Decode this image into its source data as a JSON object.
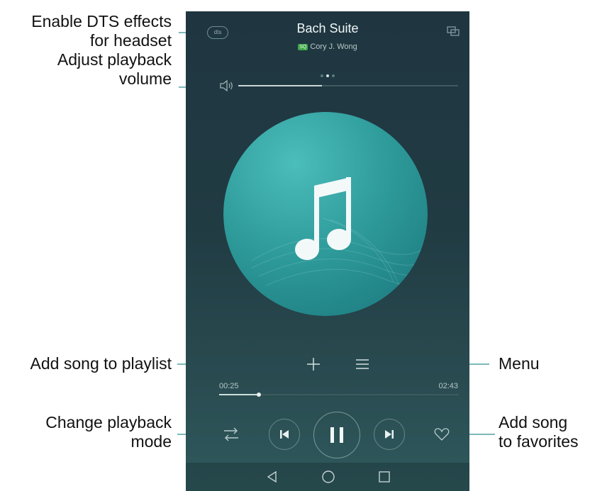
{
  "callouts": {
    "dts": "Enable DTS effects for headset",
    "dts_line1": "Enable DTS effects",
    "dts_line2": "for headset",
    "volume_line1": "Adjust playback",
    "volume_line2": "volume",
    "playlist": "Add song to playlist",
    "menu": "Menu",
    "mode_line1": "Change playback",
    "mode_line2": "mode",
    "fav_line1": "Add song",
    "fav_line2": "to favorites"
  },
  "player": {
    "title": "Bach Suite",
    "artist": "Cory J. Wong",
    "quality_badge": "SQ",
    "dts_label": "dts",
    "elapsed": "00:25",
    "duration": "02:43",
    "progress_fraction": 0.165,
    "volume_fraction": 0.38,
    "page_dots": 3,
    "active_page": 2,
    "is_playing": true
  },
  "icons": [
    "dts-icon",
    "cast-icon",
    "volume-icon",
    "music-note-icon",
    "add-icon",
    "menu-icon",
    "shuffle-repeat-icon",
    "previous-icon",
    "pause-icon",
    "next-icon",
    "heart-icon",
    "nav-back-icon",
    "nav-home-icon",
    "nav-recents-icon"
  ],
  "colors": {
    "background_top": "#1f3640",
    "background_bottom": "#2f5a5d",
    "album_teal": "#3aa8a8",
    "accent_badge": "#3fa64a"
  }
}
